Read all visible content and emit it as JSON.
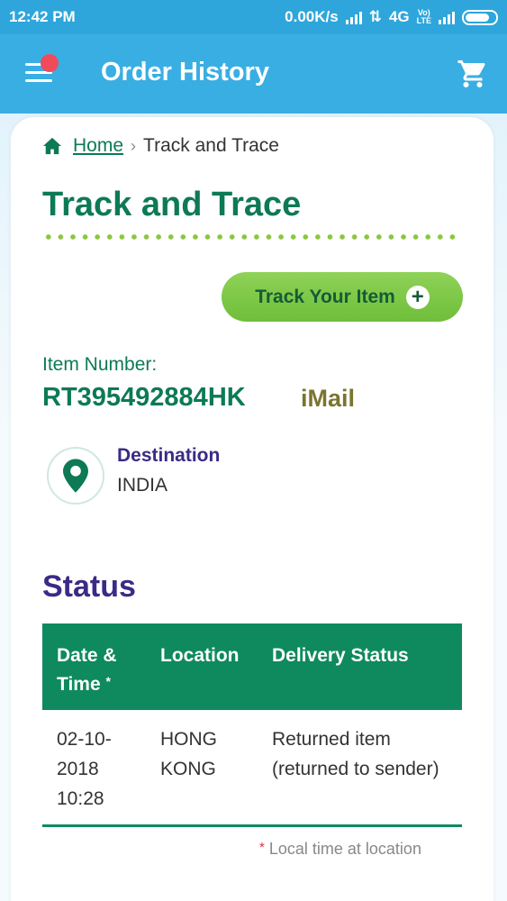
{
  "status_bar": {
    "time": "12:42 PM",
    "speed": "0.00K/s",
    "network": "4G",
    "volte_top": "Vo)",
    "volte_bottom": "LTE"
  },
  "app_bar": {
    "title": "Order History",
    "menu_icon": "hamburger-menu-icon",
    "cart_icon": "shopping-cart-icon",
    "accent": "#39aee3"
  },
  "breadcrumb": {
    "home": "Home",
    "separator": "›",
    "current": "Track and Trace"
  },
  "page": {
    "title": "Track and Trace",
    "track_button": "Track Your Item",
    "plus": "+"
  },
  "item": {
    "label": "Item Number:",
    "number": "RT395492884HK",
    "service": "iMail"
  },
  "destination": {
    "label": "Destination",
    "value": "INDIA"
  },
  "status": {
    "heading": "Status",
    "columns": {
      "date": "Date & Time",
      "date_star": "*",
      "location": "Location",
      "delivery": "Delivery Status"
    },
    "rows": [
      {
        "date": "02-10-2018 10:28",
        "location": "HONG KONG",
        "delivery_status": "Returned item (returned to sender)"
      }
    ],
    "footnote_star": "*",
    "footnote": "Local time at location"
  },
  "colors": {
    "primary_green": "#0d7a55",
    "table_header": "#0e8a5e",
    "button_green": "#7cc746",
    "purple_heading": "#3b2a86",
    "service_olive": "#7a7430"
  }
}
